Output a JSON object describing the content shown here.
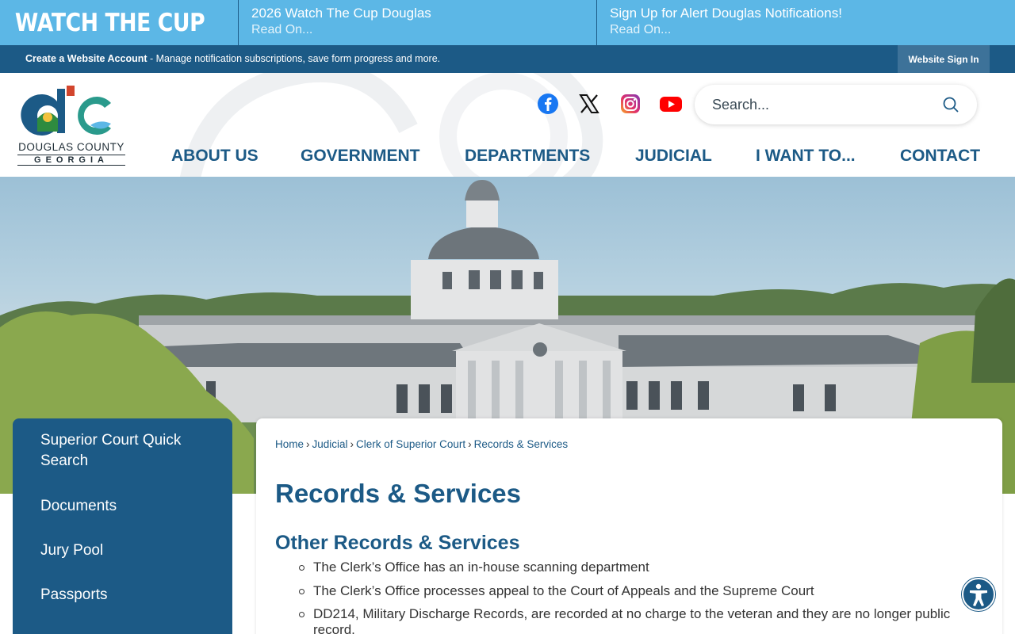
{
  "topbar": {
    "brand": "WATCH THE CUP",
    "alerts": [
      {
        "title": "2026 Watch The Cup Douglas",
        "more": "Read On..."
      },
      {
        "title": "Sign Up for Alert Douglas Notifications!",
        "more": "Read On..."
      }
    ]
  },
  "accountbar": {
    "create_label": "Create a Website Account",
    "create_desc": " - Manage notification subscriptions, save form progress and more.",
    "signin_label": "Website Sign In"
  },
  "header": {
    "logo_county": "DOUGLAS COUNTY",
    "logo_state": "GEORGIA",
    "social_icons": [
      "facebook-icon",
      "x-icon",
      "instagram-icon",
      "youtube-icon"
    ],
    "search_placeholder": "Search...",
    "nav": [
      "ABOUT US",
      "GOVERNMENT",
      "DEPARTMENTS",
      "JUDICIAL",
      "I WANT TO...",
      "CONTACT"
    ]
  },
  "sidebar": {
    "items": [
      "Superior Court Quick Search",
      "Documents",
      "Jury Pool",
      "Passports"
    ]
  },
  "main": {
    "breadcrumb": [
      "Home",
      "Judicial",
      "Clerk of Superior Court",
      "Records & Services"
    ],
    "breadcrumb_sep": "›",
    "title": "Records & Services",
    "section_title": "Other Records & Services",
    "bullets": [
      "The Clerk’s Office has an in-house scanning department",
      "The Clerk’s Office processes appeal to the Court of Appeals and the Supreme Court",
      "DD214, Military Discharge Records, are recorded at no charge to the veteran and they are no longer public record."
    ]
  },
  "colors": {
    "brand_blue": "#1c5a86",
    "banner_blue": "#5cb7e6",
    "facebook": "#1877f2",
    "youtube": "#ff0000"
  }
}
